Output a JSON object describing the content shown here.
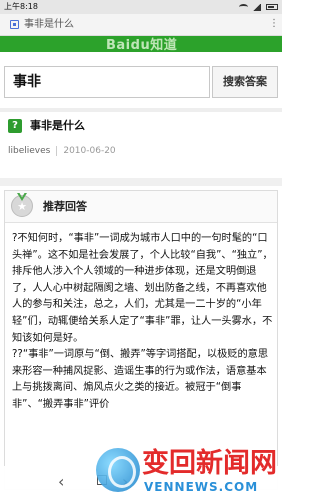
{
  "status_bar": {
    "time": "上午8:18"
  },
  "browser": {
    "tab_title": "事非是什么"
  },
  "brand": {
    "logo_text": "Baidu知道"
  },
  "search": {
    "query": "事非",
    "button_label": "搜索答案"
  },
  "question": {
    "icon_glyph": "?",
    "title": "事非是什么",
    "author": "libelieves",
    "date": "2010-06-20"
  },
  "answer": {
    "header_label": "推荐回答",
    "badge_glyph": "★",
    "paragraphs": [
      "?不知何时，“事非”一词成为城市人口中的一句时髦的“口头禅”。这不如是社会发展了，个人比较“自我”、“独立”，排斥他人涉入个人领域的一种进步体现，还是文明倒退了，人人心中树起隔阂之墙、划出防备之线，不再喜欢他人的参与和关注，总之，人们，尤其是一二十岁的“小年轻”们，动辄便给关系人定了“事非”罪，让人一头雾水，不知该如何是好。",
      "??“事非”一词原与“倒、搬弄”等字词搭配，以极贬的意思来形容一种捕风捉影、造谣生事的行为或作法，语意基本上与挑拨离间、煽风点火之类的接近。被冠于“倒事非”、“搬弄事非”评价"
    ]
  },
  "watermark": {
    "cn": "变回新闻网",
    "en": "VENNEWS.COM"
  },
  "colors": {
    "brand_green": "#2ca22b",
    "icon_green": "#2e9c2f",
    "watermark_red": "#e32b2b"
  }
}
